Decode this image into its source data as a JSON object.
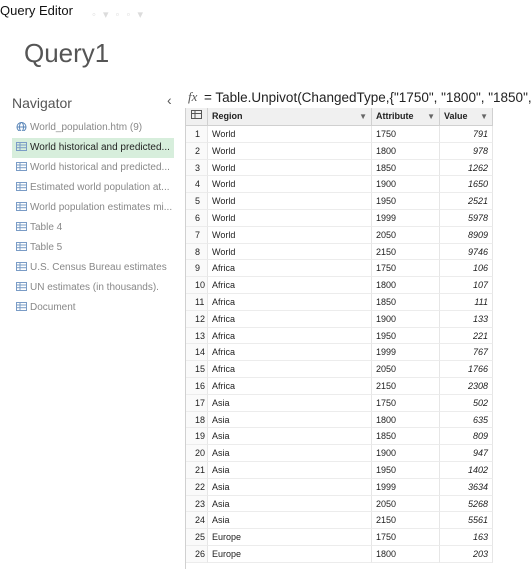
{
  "window": {
    "title": "Query Editor"
  },
  "query": {
    "name": "Query1"
  },
  "navigator": {
    "header": "Navigator",
    "collapse_glyph": "‹",
    "items": [
      {
        "label": "World_population.htm (9)",
        "icon": "globe-icon",
        "selected": false
      },
      {
        "label": "World historical and predicted...",
        "icon": "table-icon",
        "selected": true
      },
      {
        "label": "World historical and predicted...",
        "icon": "table-icon",
        "selected": false
      },
      {
        "label": "Estimated world population at...",
        "icon": "table-icon",
        "selected": false
      },
      {
        "label": "World population estimates mi...",
        "icon": "table-icon",
        "selected": false
      },
      {
        "label": "Table 4",
        "icon": "table-icon",
        "selected": false
      },
      {
        "label": "Table 5",
        "icon": "table-icon",
        "selected": false
      },
      {
        "label": "U.S. Census Bureau estimates",
        "icon": "table-icon",
        "selected": false
      },
      {
        "label": "UN estimates (in thousands).",
        "icon": "table-icon",
        "selected": false
      },
      {
        "label": "Document",
        "icon": "table-icon",
        "selected": false
      }
    ]
  },
  "formula": {
    "fx": "fx",
    "text": "= Table.Unpivot(ChangedType,{\"1750\", \"1800\", \"1850\", \""
  },
  "grid": {
    "columns": [
      {
        "label": "Region"
      },
      {
        "label": "Attribute"
      },
      {
        "label": "Value"
      }
    ],
    "rows": [
      {
        "idx": "1",
        "region": "World",
        "attribute": "1750",
        "value": "791"
      },
      {
        "idx": "2",
        "region": "World",
        "attribute": "1800",
        "value": "978"
      },
      {
        "idx": "3",
        "region": "World",
        "attribute": "1850",
        "value": "1262"
      },
      {
        "idx": "4",
        "region": "World",
        "attribute": "1900",
        "value": "1650"
      },
      {
        "idx": "5",
        "region": "World",
        "attribute": "1950",
        "value": "2521"
      },
      {
        "idx": "6",
        "region": "World",
        "attribute": "1999",
        "value": "5978"
      },
      {
        "idx": "7",
        "region": "World",
        "attribute": "2050",
        "value": "8909"
      },
      {
        "idx": "8",
        "region": "World",
        "attribute": "2150",
        "value": "9746"
      },
      {
        "idx": "9",
        "region": "Africa",
        "attribute": "1750",
        "value": "106"
      },
      {
        "idx": "10",
        "region": "Africa",
        "attribute": "1800",
        "value": "107"
      },
      {
        "idx": "11",
        "region": "Africa",
        "attribute": "1850",
        "value": "111"
      },
      {
        "idx": "12",
        "region": "Africa",
        "attribute": "1900",
        "value": "133"
      },
      {
        "idx": "13",
        "region": "Africa",
        "attribute": "1950",
        "value": "221"
      },
      {
        "idx": "14",
        "region": "Africa",
        "attribute": "1999",
        "value": "767"
      },
      {
        "idx": "15",
        "region": "Africa",
        "attribute": "2050",
        "value": "1766"
      },
      {
        "idx": "16",
        "region": "Africa",
        "attribute": "2150",
        "value": "2308"
      },
      {
        "idx": "17",
        "region": "Asia",
        "attribute": "1750",
        "value": "502"
      },
      {
        "idx": "18",
        "region": "Asia",
        "attribute": "1800",
        "value": "635"
      },
      {
        "idx": "19",
        "region": "Asia",
        "attribute": "1850",
        "value": "809"
      },
      {
        "idx": "20",
        "region": "Asia",
        "attribute": "1900",
        "value": "947"
      },
      {
        "idx": "21",
        "region": "Asia",
        "attribute": "1950",
        "value": "1402"
      },
      {
        "idx": "22",
        "region": "Asia",
        "attribute": "1999",
        "value": "3634"
      },
      {
        "idx": "23",
        "region": "Asia",
        "attribute": "2050",
        "value": "5268"
      },
      {
        "idx": "24",
        "region": "Asia",
        "attribute": "2150",
        "value": "5561"
      },
      {
        "idx": "25",
        "region": "Europe",
        "attribute": "1750",
        "value": "163"
      },
      {
        "idx": "26",
        "region": "Europe",
        "attribute": "1800",
        "value": "203"
      }
    ]
  },
  "colors": {
    "selected_bg": "#d7eedc",
    "grid_header_bg": "#f0f0f0",
    "table_icon": "#7a9cc6",
    "globe_icon": "#5a86b8"
  }
}
